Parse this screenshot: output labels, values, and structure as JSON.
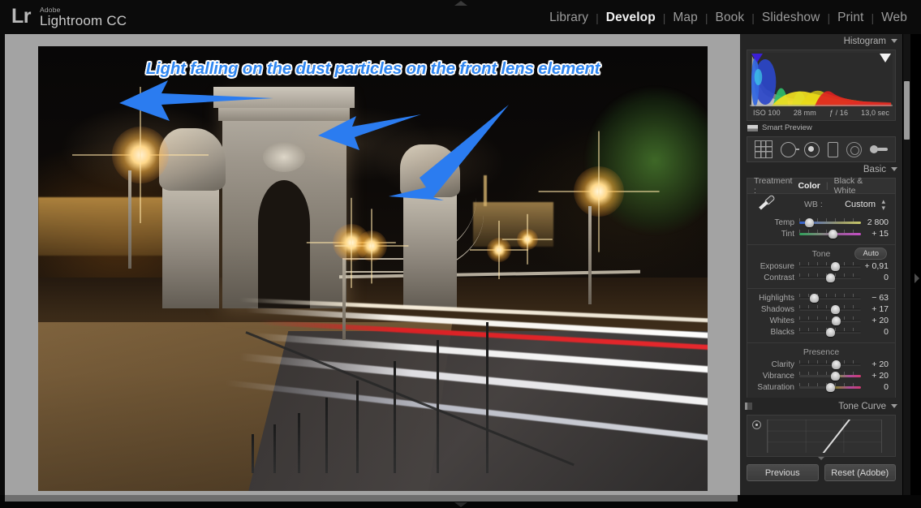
{
  "app": {
    "logo_mark": "Lr",
    "brand_line1": "Adobe",
    "brand_line2": "Lightroom CC"
  },
  "modules": [
    {
      "label": "Library",
      "active": false
    },
    {
      "label": "Develop",
      "active": true
    },
    {
      "label": "Map",
      "active": false
    },
    {
      "label": "Book",
      "active": false
    },
    {
      "label": "Slideshow",
      "active": false
    },
    {
      "label": "Print",
      "active": false
    },
    {
      "label": "Web",
      "active": false
    }
  ],
  "module_separator": "|",
  "annotation": {
    "text": "Light falling on the dust particles on the front lens element",
    "color": "#2f86f0",
    "outline_color": "#ffffff",
    "arrow_color": "#2b7cf0",
    "arrow_count": 3
  },
  "histogram_panel": {
    "title": "Histogram",
    "iso": "ISO 100",
    "focal_length": "28 mm",
    "aperture": "ƒ / 16",
    "shutter": "13,0 sec",
    "smart_preview": "Smart Preview",
    "clip_left_color": "#3b1fd6",
    "clip_right_color": "#f2f2f2"
  },
  "tools": [
    {
      "name": "crop-overlay-tool"
    },
    {
      "name": "spot-removal-tool"
    },
    {
      "name": "red-eye-correction-tool"
    },
    {
      "name": "graduated-filter-tool"
    },
    {
      "name": "radial-filter-tool"
    },
    {
      "name": "adjustment-brush-tool"
    }
  ],
  "basic_panel": {
    "title": "Basic",
    "treatment_label": "Treatment :",
    "treatment_options": [
      {
        "label": "Color",
        "active": true
      },
      {
        "label": "Black & White",
        "active": false
      }
    ],
    "treatment_divider": "|",
    "wb_label": "WB :",
    "wb_value": "Custom",
    "wb_sliders": [
      {
        "label": "Temp",
        "value": "2 800",
        "pos": 16,
        "track": "temp"
      },
      {
        "label": "Tint",
        "value": "+ 15",
        "pos": 55,
        "track": "tint"
      }
    ],
    "tone_title": "Tone",
    "auto_label": "Auto",
    "tone_sliders": [
      {
        "label": "Exposure",
        "value": "+ 0,91",
        "pos": 58,
        "track": "plain"
      },
      {
        "label": "Contrast",
        "value": "0",
        "pos": 50,
        "track": "plain"
      },
      {
        "label": "Highlights",
        "value": "− 63",
        "pos": 24,
        "track": "plain"
      },
      {
        "label": "Shadows",
        "value": "+ 17",
        "pos": 59,
        "track": "plain"
      },
      {
        "label": "Whites",
        "value": "+ 20",
        "pos": 60,
        "track": "plain"
      },
      {
        "label": "Blacks",
        "value": "0",
        "pos": 50,
        "track": "plain"
      }
    ],
    "presence_title": "Presence",
    "presence_sliders": [
      {
        "label": "Clarity",
        "value": "+ 20",
        "pos": 60,
        "track": "plain"
      },
      {
        "label": "Vibrance",
        "value": "+ 20",
        "pos": 59,
        "track": "vib"
      },
      {
        "label": "Saturation",
        "value": "0",
        "pos": 50,
        "track": "sat"
      }
    ]
  },
  "tone_curve_panel": {
    "title": "Tone Curve"
  },
  "footer_buttons": [
    {
      "label": "Previous",
      "name": "previous-button"
    },
    {
      "label": "Reset (Adobe)",
      "name": "reset-button"
    }
  ]
}
